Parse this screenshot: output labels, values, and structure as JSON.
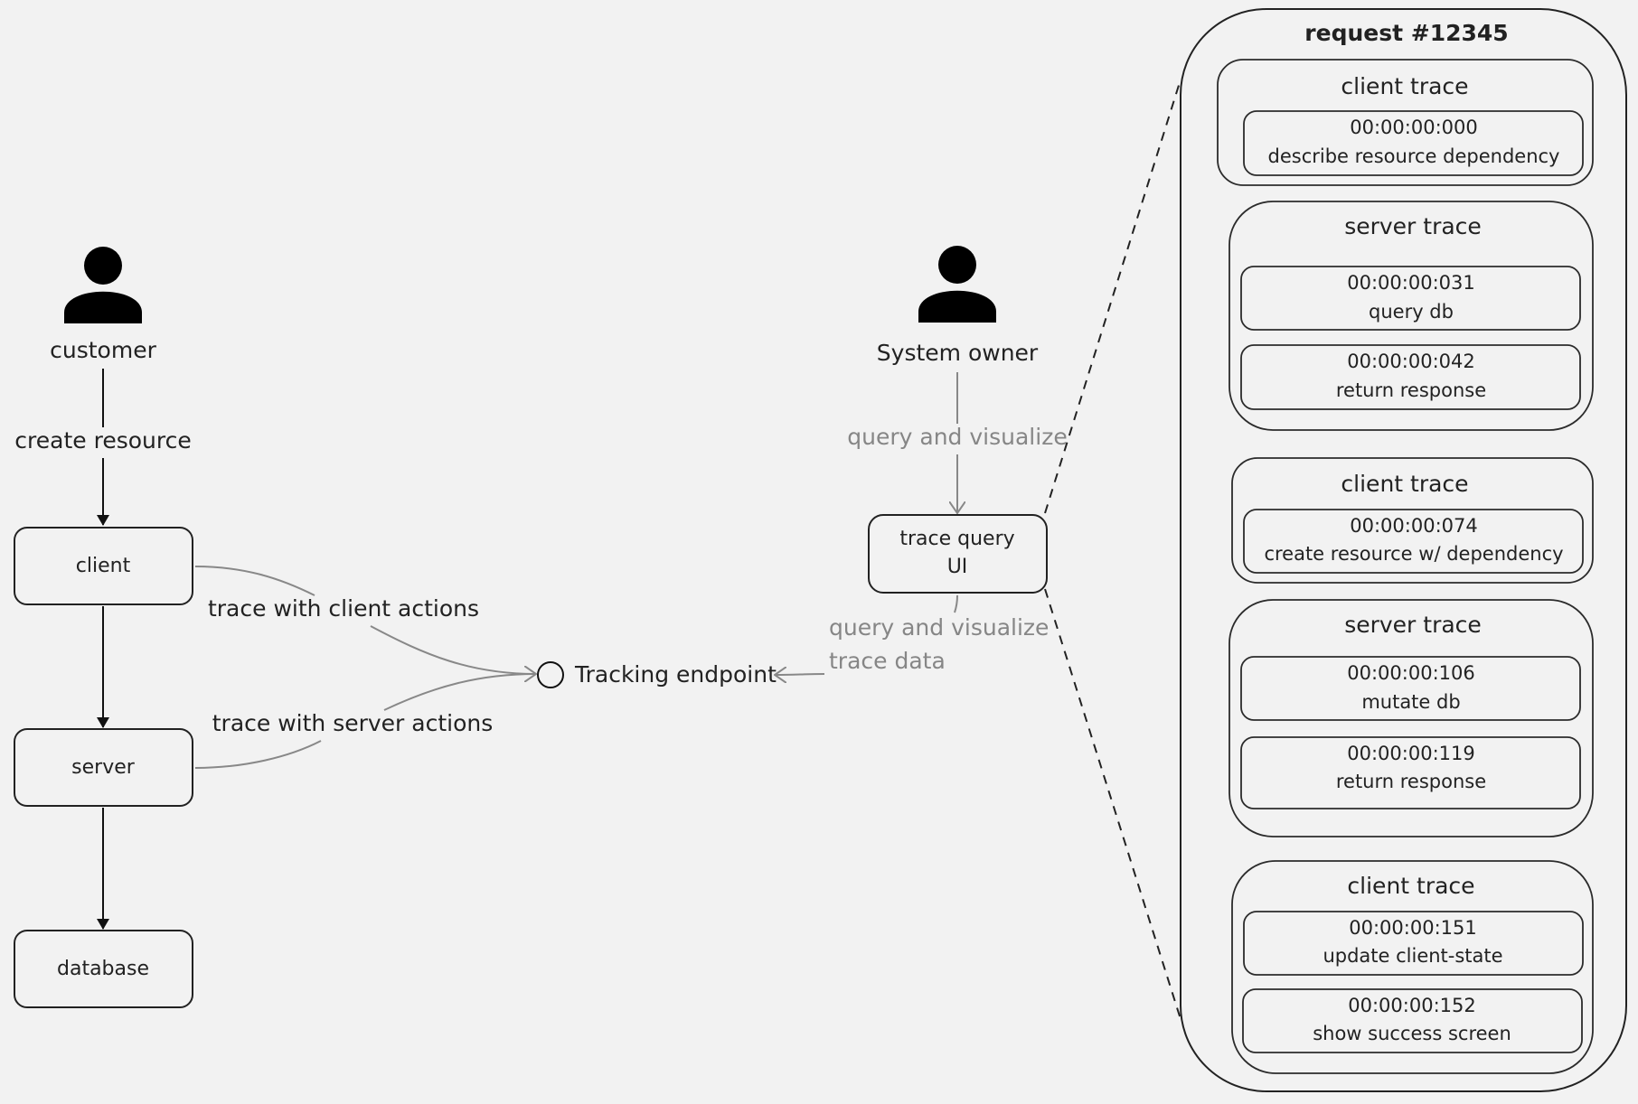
{
  "diagram": {
    "actors": {
      "customer": {
        "label": "customer",
        "icon": "person-icon"
      },
      "system_owner": {
        "label": "System owner",
        "icon": "person-icon"
      }
    },
    "nodes": {
      "client": "client",
      "server": "server",
      "database": "database",
      "trace_query_ui": [
        "trace query",
        "UI"
      ],
      "tracking_endpoint": "Tracking endpoint"
    },
    "edges": {
      "create_resource": "create resource",
      "trace_client": "trace with client actions",
      "trace_server": "trace with server actions",
      "owner_query": "query and visualize",
      "ui_query": [
        "query and visualize",
        "trace data"
      ]
    },
    "colors": {
      "background": "#f2f2f2",
      "stroke": "#222222",
      "muted_edge": "#888888"
    }
  },
  "request": {
    "title": "request #12345",
    "groups": [
      {
        "title": "client trace",
        "events": [
          {
            "time": "00:00:00:000",
            "action": "describe resource dependency"
          }
        ]
      },
      {
        "title": "server trace",
        "events": [
          {
            "time": "00:00:00:031",
            "action": "query db"
          },
          {
            "time": "00:00:00:042",
            "action": "return response"
          }
        ]
      },
      {
        "title": "client trace",
        "events": [
          {
            "time": "00:00:00:074",
            "action": "create resource w/ dependency"
          }
        ]
      },
      {
        "title": "server trace",
        "events": [
          {
            "time": "00:00:00:106",
            "action": "mutate db"
          },
          {
            "time": "00:00:00:119",
            "action": "return response"
          }
        ]
      },
      {
        "title": "client trace",
        "events": [
          {
            "time": "00:00:00:151",
            "action": "update client-state"
          },
          {
            "time": "00:00:00:152",
            "action": "show success screen"
          }
        ]
      }
    ]
  }
}
